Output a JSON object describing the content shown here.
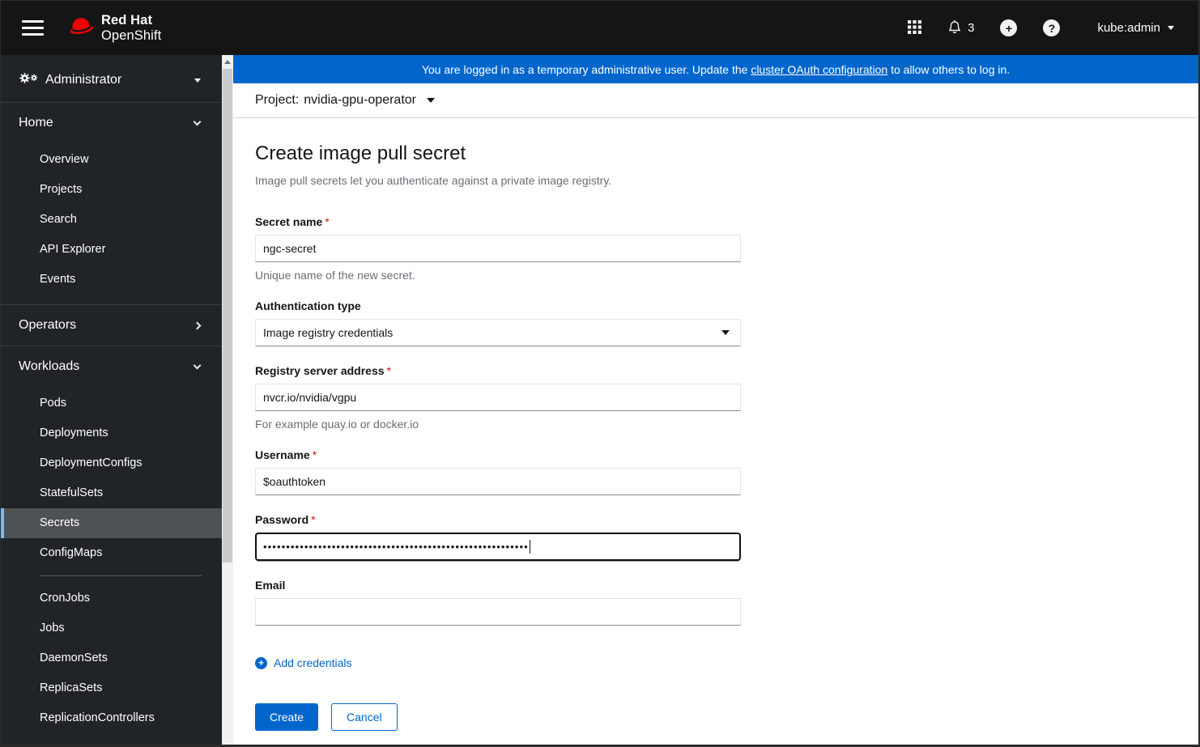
{
  "header": {
    "brand_line1": "Red Hat",
    "brand_line2": "OpenShift",
    "notification_count": "3",
    "plus_glyph": "+",
    "help_glyph": "?",
    "username": "kube:admin"
  },
  "sidebar": {
    "perspective": "Administrator",
    "home": {
      "label": "Home",
      "items": [
        "Overview",
        "Projects",
        "Search",
        "API Explorer",
        "Events"
      ]
    },
    "operators": {
      "label": "Operators"
    },
    "workloads": {
      "label": "Workloads",
      "items_top": [
        "Pods",
        "Deployments",
        "DeploymentConfigs",
        "StatefulSets",
        "Secrets",
        "ConfigMaps"
      ],
      "items_bottom": [
        "CronJobs",
        "Jobs",
        "DaemonSets",
        "ReplicaSets",
        "ReplicationControllers"
      ],
      "selected_item": "Secrets"
    }
  },
  "banner": {
    "text_before": "You are logged in as a temporary administrative user. Update the ",
    "link_text": "cluster OAuth configuration",
    "text_after": " to allow others to log in."
  },
  "project_bar": {
    "label": "Project:",
    "value": "nvidia-gpu-operator"
  },
  "page": {
    "title": "Create image pull secret",
    "description": "Image pull secrets let you authenticate against a private image registry."
  },
  "form": {
    "required_marker": "*",
    "secret_name": {
      "label": "Secret name",
      "value": "ngc-secret",
      "help": "Unique name of the new secret."
    },
    "auth_type": {
      "label": "Authentication type",
      "value": "Image registry credentials"
    },
    "registry_address": {
      "label": "Registry server address",
      "value": "nvcr.io/nvidia/vgpu",
      "help": "For example quay.io or docker.io"
    },
    "username": {
      "label": "Username",
      "value": "$oauthtoken"
    },
    "password": {
      "label": "Password",
      "masked_value": "••••••••••••••••••••••••••••••••••••••••••••••••••••••••••"
    },
    "email": {
      "label": "Email",
      "value": ""
    },
    "add_credentials_label": "Add credentials",
    "create_label": "Create",
    "cancel_label": "Cancel"
  },
  "colors": {
    "accent_blue": "#0066cc",
    "masthead_black": "#151515",
    "sidebar_dark": "#212427",
    "nav_selected_bg": "#4f5255",
    "nav_selected_border": "#73bcf7",
    "required_red": "#c9190b",
    "helper_gray": "#6a6e73"
  }
}
